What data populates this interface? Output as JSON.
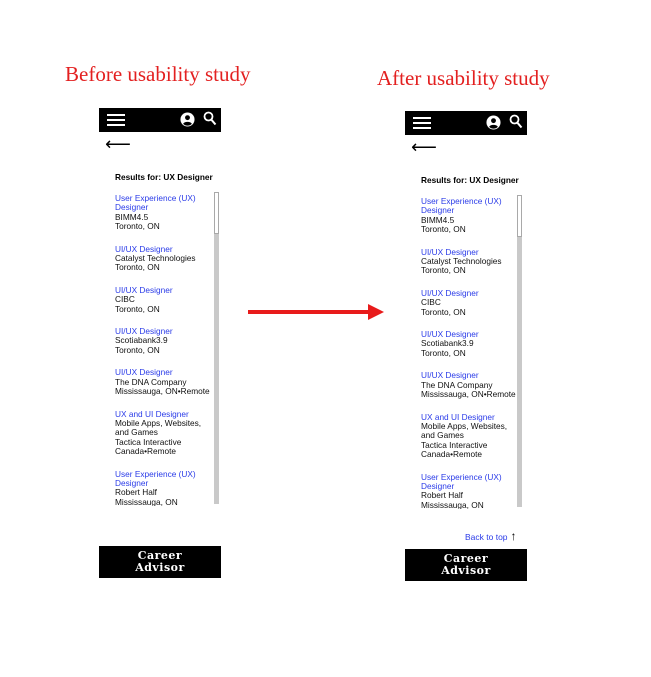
{
  "captions": {
    "before": "Before usability study",
    "after": "After usability study"
  },
  "icons": {
    "menu": "hamburger-menu-icon",
    "user": "user-account-icon",
    "search": "search-icon",
    "back": "back-arrow-icon"
  },
  "colors": {
    "caption": "#e32020",
    "link": "#2a3be8",
    "bar": "#000000",
    "arrow": "#e81b1b"
  },
  "before": {
    "back_arrow": "⟵",
    "results_label": "Results for:  UX Designer",
    "jobs": [
      {
        "title": "User Experience (UX) Designer",
        "lines": [
          "BIMM4.5",
          "Toronto, ON"
        ]
      },
      {
        "title": "UI/UX Designer",
        "lines": [
          "Catalyst Technologies",
          "Toronto, ON"
        ]
      },
      {
        "title": "UI/UX Designer",
        "lines": [
          "CIBC",
          "Toronto, ON"
        ]
      },
      {
        "title": "UI/UX Designer",
        "lines": [
          "Scotiabank3.9",
          "Toronto, ON"
        ]
      },
      {
        "title": "UI/UX Designer",
        "lines": [
          "The DNA Company",
          "Mississauga, ON•Remote"
        ]
      },
      {
        "title": "UX and UI Designer",
        "lines": [
          "Mobile Apps, Websites, and Games",
          "Tactica Interactive",
          "Canada•Remote"
        ]
      },
      {
        "title": "User Experience (UX) Designer",
        "lines": [
          "Robert Half",
          "Mississauga, ON"
        ]
      }
    ],
    "logo": {
      "line1": "Career",
      "line2": "Advisor"
    }
  },
  "after": {
    "back_arrow": "⟵",
    "results_label": "Results for:  UX Designer",
    "jobs": [
      {
        "title": "User Experience (UX) Designer",
        "lines": [
          "BIMM4.5",
          "Toronto, ON"
        ]
      },
      {
        "title": "UI/UX Designer",
        "lines": [
          "Catalyst Technologies",
          "Toronto, ON"
        ]
      },
      {
        "title": "UI/UX Designer",
        "lines": [
          "CIBC",
          "Toronto, ON"
        ]
      },
      {
        "title": "UI/UX Designer",
        "lines": [
          "Scotiabank3.9",
          "Toronto, ON"
        ]
      },
      {
        "title": "UI/UX Designer",
        "lines": [
          "The DNA Company",
          "Mississauga, ON•Remote"
        ]
      },
      {
        "title": "UX and UI Designer",
        "lines": [
          "Mobile Apps, Websites, and Games",
          "Tactica Interactive",
          "Canada•Remote"
        ]
      },
      {
        "title": "User Experience (UX) Designer",
        "lines": [
          "Robert Half",
          "Mississauga, ON"
        ]
      }
    ],
    "back_to_top": "Back to top",
    "back_to_top_arrow": "↑",
    "logo": {
      "line1": "Career",
      "line2": "Advisor"
    }
  }
}
